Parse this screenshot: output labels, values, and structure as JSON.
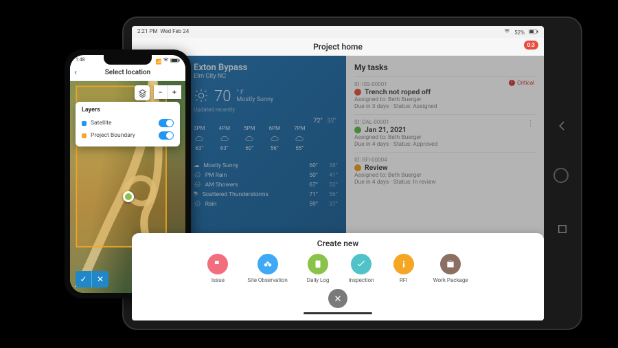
{
  "tablet": {
    "status": {
      "time": "2:21 PM",
      "date": "Wed Feb 24",
      "battery": "52%",
      "wifi_icon": "wifi",
      "battery_icon": "battery"
    },
    "header": {
      "title": "Project home",
      "record": "0:3"
    },
    "weather": {
      "project_name": "Exton Bypass",
      "project_location": "Elm City NC",
      "temp": "70",
      "unit_top": "° F",
      "unit_bottom": "Mostly Sunny",
      "updated": "Updated recently",
      "today_hi": "72°",
      "today_lo": "32°",
      "hourly": [
        {
          "time": "3PM",
          "temp": "63°"
        },
        {
          "time": "4PM",
          "temp": "63°"
        },
        {
          "time": "5PM",
          "temp": "60°"
        },
        {
          "time": "6PM",
          "temp": "56°"
        },
        {
          "time": "7PM",
          "temp": "55°"
        }
      ],
      "conditions": [
        {
          "label": "Mostly Sunny",
          "hi": "60°",
          "lo": "38°"
        },
        {
          "label": "PM Rain",
          "hi": "50°",
          "lo": "41°"
        },
        {
          "label": "AM Showers",
          "hi": "67°",
          "lo": "52°"
        },
        {
          "label": "Scattered Thunderstorms",
          "hi": "71°",
          "lo": "56°"
        },
        {
          "label": "Rain",
          "hi": "59°",
          "lo": "37°"
        }
      ]
    },
    "tasks": {
      "title": "My tasks",
      "critical_label": "Critical",
      "items": [
        {
          "id": "ID: ISS-00001",
          "name": "Trench not roped off",
          "dot": "dot-red",
          "line1": "Assigned to: Beth Buerger",
          "line2": "Due in 3 days · Status: Assigned",
          "critical": true
        },
        {
          "id": "ID: DAL-00001",
          "name": "Jan 21, 2021",
          "dot": "dot-green",
          "line1": "Assigned to: Beth Buerger",
          "line2": "Due in 4 days · Status: Approved",
          "more": true
        },
        {
          "id": "ID: RFI-00004",
          "name": "Review",
          "dot": "dot-orange",
          "line1": "Assigned to: Beth Buerger",
          "line2": "Due in 4 days · Status: In review"
        }
      ]
    },
    "sheet": {
      "title": "Create new",
      "items": [
        {
          "label": "Issue",
          "color": "c-pink",
          "icon": "flag-icon"
        },
        {
          "label": "Site Observation",
          "color": "c-blue",
          "icon": "binoculars-icon"
        },
        {
          "label": "Daily Log",
          "color": "c-green",
          "icon": "notebook-icon"
        },
        {
          "label": "Inspection",
          "color": "c-teal",
          "icon": "checklist-icon"
        },
        {
          "label": "RFI",
          "color": "c-orange",
          "icon": "info-icon"
        },
        {
          "label": "Work Package",
          "color": "c-brown",
          "icon": "package-icon"
        }
      ]
    }
  },
  "phone": {
    "status": {
      "left": "1:48",
      "carrier": "",
      "right": ""
    },
    "header": {
      "title": "Select location"
    },
    "zoom": {
      "out": "−",
      "in": "+"
    },
    "layers": {
      "title": "Layers",
      "rows": [
        {
          "label": "Satellite",
          "color": "#2196f3"
        },
        {
          "label": "Project Boundary",
          "color": "#f5a623"
        }
      ]
    }
  }
}
